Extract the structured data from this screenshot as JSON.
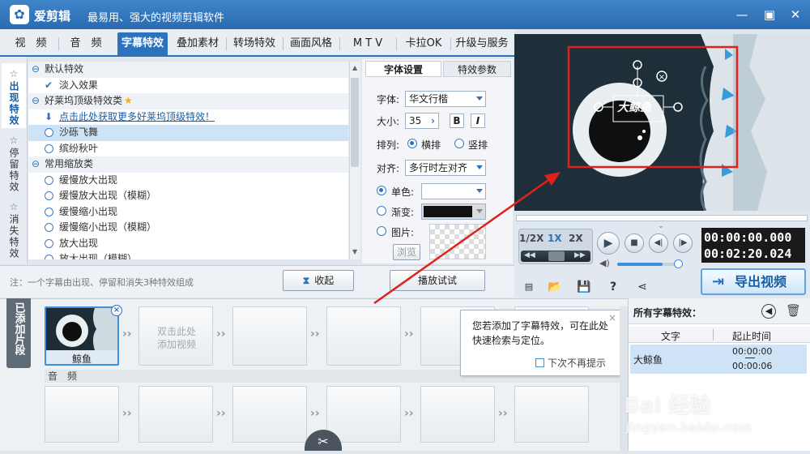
{
  "app": {
    "name": "爱剪辑",
    "slogan": "最易用、强大的视频剪辑软件",
    "logo_icon": "film-reel-icon"
  },
  "tabs": [
    {
      "label": "视　频",
      "active": false
    },
    {
      "label": "音　频",
      "active": false
    },
    {
      "label": "字幕特效",
      "active": true
    },
    {
      "label": "叠加素材",
      "active": false
    },
    {
      "label": "转场特效",
      "active": false
    },
    {
      "label": "画面风格",
      "active": false
    },
    {
      "label": "M T V",
      "active": false
    },
    {
      "label": "卡拉OK",
      "active": false
    },
    {
      "label": "升级与服务",
      "active": false
    }
  ],
  "side_tabs": [
    {
      "label": "出现特效",
      "active": true
    },
    {
      "label": "停留特效",
      "active": false
    },
    {
      "label": "消失特效",
      "active": false
    }
  ],
  "effects": {
    "default_category": "默认特效",
    "default_item": "淡入效果",
    "hollywood_category": "好莱坞顶级特效类",
    "hollywood_link": "点击此处获取更多好莱坞顶级特效！",
    "hollywood_items": [
      "沙砾飞舞",
      "缤纷秋叶"
    ],
    "selected_item": "沙砾飞舞",
    "zoom_category": "常用缩放类",
    "zoom_items": [
      "缓慢放大出现",
      "缓慢放大出现（模糊）",
      "缓慢缩小出现",
      "缓慢缩小出现（模糊）",
      "放大出现",
      "放大出现（模糊）"
    ]
  },
  "settings": {
    "tab_font": "字体设置",
    "tab_effect": "特效参数",
    "font_label": "字体:",
    "font_value": "华文行楷",
    "size_label": "大小:",
    "size_value": "35",
    "bold": "B",
    "italic": "I",
    "layout_label": "排列:",
    "layout_horizontal": "横排",
    "layout_vertical": "竖排",
    "align_label": "对齐:",
    "align_value": "多行时左对齐",
    "solid_label": "单色:",
    "gradient_label": "渐变:",
    "image_label": "图片:",
    "browse": "浏览"
  },
  "note": "注：一个字幕由出现、停留和消失3种特效组成",
  "collapse_button": "收起",
  "play_test_button": "播放试试",
  "preview": {
    "caption": "大鲸鱼"
  },
  "player": {
    "speed_half": "1/2X",
    "speed_1x": "1X",
    "speed_2x": "2X",
    "current_time": "00:00:00.000",
    "total_time": "00:02:20.024",
    "volume": 0.72
  },
  "export_button": "导出视频",
  "timeline": {
    "side_label": "已添加片段",
    "clip_name": "鲸鱼",
    "add_hint": "双击此处添加视频",
    "audio_label": "音　频"
  },
  "tooltip": {
    "text": "您若添加了字幕特效，可在此处快速检索与定位。",
    "no_remind": "下次不再提示"
  },
  "subtitles": {
    "title": "所有字幕特效：",
    "col_text": "文字",
    "col_time": "起止时间",
    "rows": [
      {
        "text": "大鲸鱼",
        "start": "00:00:00",
        "end": "00:00:06"
      }
    ]
  },
  "watermark": {
    "line1": "Bai 经验",
    "line2": "jingyan.baidu.com"
  },
  "colors": {
    "accent": "#2d72bc",
    "annotation": "#e0201b"
  }
}
